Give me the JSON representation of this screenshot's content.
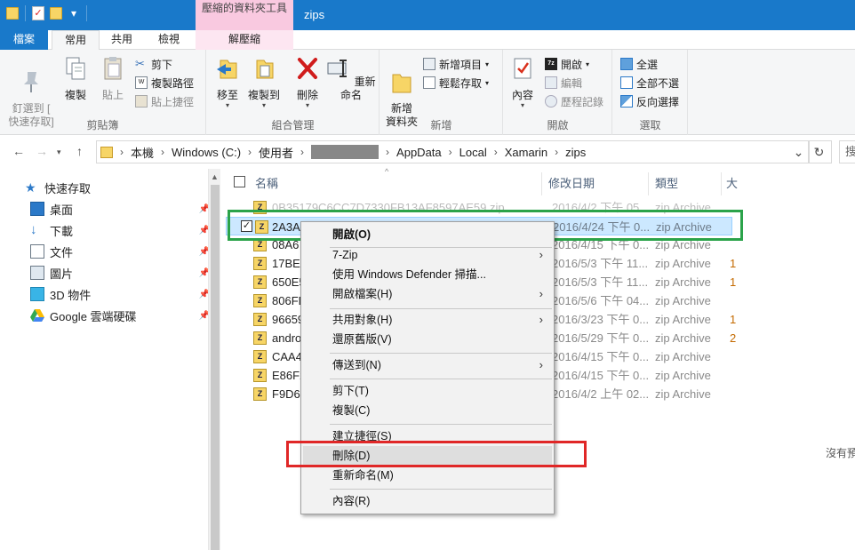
{
  "titlebar": {
    "context_tab_header": "壓縮的資料夾工具",
    "window_title": "zips",
    "colors": {
      "titlebar": "#1979ca",
      "context_header": "#f9c9e0"
    }
  },
  "tabs": {
    "file": "檔案",
    "home": "常用",
    "share": "共用",
    "view": "檢視",
    "extract": "解壓縮"
  },
  "ribbon": {
    "clipboard": {
      "label": "剪貼簿",
      "pin_quick_access": "釘選到 [\n快速存取]",
      "copy": "複製",
      "paste": "貼上",
      "cut": "剪下",
      "copy_path": "複製路徑",
      "paste_shortcut": "貼上捷徑"
    },
    "organize": {
      "label": "組合管理",
      "move_to": "移至",
      "copy_to": "複製到",
      "delete": "刪除",
      "rename": "重新命名"
    },
    "new": {
      "label": "新增",
      "new_folder": "新增\n資料夾",
      "new_item": "新增項目",
      "easy_access": "輕鬆存取"
    },
    "open": {
      "label": "開啟",
      "properties": "內容",
      "open": "開啟",
      "edit": "編輯",
      "history": "歷程記錄"
    },
    "select": {
      "label": "選取",
      "select_all": "全選",
      "select_none": "全部不選",
      "invert": "反向選擇"
    }
  },
  "address": {
    "crumbs": [
      "本機",
      "Windows (C:)",
      "使用者",
      "AppData",
      "Local",
      "Xamarin",
      "zips"
    ],
    "search_placeholder": "搜"
  },
  "sidebar": {
    "items": [
      {
        "label": "快速存取",
        "icon": "star-icon",
        "pinned": false
      },
      {
        "label": "桌面",
        "icon": "desktop-icon",
        "pinned": true
      },
      {
        "label": "下載",
        "icon": "download-icon",
        "pinned": true
      },
      {
        "label": "文件",
        "icon": "document-icon",
        "pinned": true
      },
      {
        "label": "圖片",
        "icon": "picture-icon",
        "pinned": true
      },
      {
        "label": "3D 物件",
        "icon": "cube-icon",
        "pinned": true
      },
      {
        "label": "Google 雲端硬碟",
        "icon": "google-drive-icon",
        "pinned": true
      }
    ]
  },
  "filelist": {
    "columns": {
      "name": "名稱",
      "date": "修改日期",
      "type": "類型",
      "size": "大"
    },
    "rows": [
      {
        "name": "0B35179C6CC7D7330FB13AF8597AE59.zip",
        "date": "2016/4/2 下午 05...",
        "type": "zip Archive",
        "size": ""
      },
      {
        "name": "2A3A8",
        "date": "2016/4/24 下午 0...",
        "type": "zip Archive",
        "size": ""
      },
      {
        "name": "08A6",
        "date": "2016/4/15 下午 0...",
        "type": "zip Archive",
        "size": ""
      },
      {
        "name": "17BE2",
        "date": "2016/5/3 下午 11...",
        "type": "zip Archive",
        "size": "1"
      },
      {
        "name": "650E5",
        "date": "2016/5/3 下午 11...",
        "type": "zip Archive",
        "size": "1"
      },
      {
        "name": "806FD",
        "date": "2016/5/6 下午 04...",
        "type": "zip Archive",
        "size": ""
      },
      {
        "name": "96659",
        "date": "2016/3/23 下午 0...",
        "type": "zip Archive",
        "size": "1"
      },
      {
        "name": "andro",
        "date": "2016/5/29 下午 0...",
        "type": "zip Archive",
        "size": "2"
      },
      {
        "name": "CAA44",
        "date": "2016/4/15 下午 0...",
        "type": "zip Archive",
        "size": ""
      },
      {
        "name": "E86F2",
        "date": "2016/4/15 下午 0...",
        "type": "zip Archive",
        "size": ""
      },
      {
        "name": "F9D6",
        "date": "2016/4/2 上午 02...",
        "type": "zip Archive",
        "size": ""
      }
    ],
    "no_preview": "沒有預"
  },
  "context_menu": {
    "open": "開啟(O)",
    "seven_zip": "7-Zip",
    "defender": "使用 Windows Defender 掃描...",
    "open_with": "開啟檔案(H)",
    "share_with": "共用對象(H)",
    "restore": "還原舊版(V)",
    "send_to": "傳送到(N)",
    "cut": "剪下(T)",
    "copy": "複製(C)",
    "create_shortcut": "建立捷徑(S)",
    "delete": "刪除(D)",
    "rename": "重新命名(M)",
    "properties": "內容(R)"
  },
  "highlights": {
    "green": "#2ba34a",
    "red": "#e02727"
  }
}
